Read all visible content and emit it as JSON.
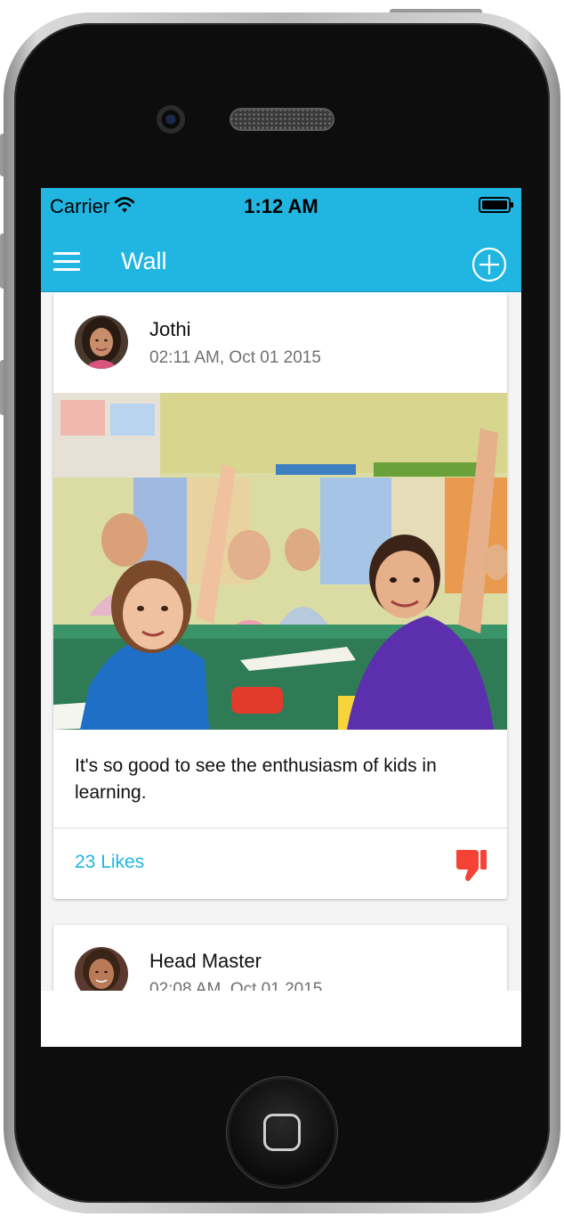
{
  "status_bar": {
    "carrier": "Carrier",
    "time": "1:12 AM",
    "icons": [
      "wifi-icon",
      "battery-icon"
    ]
  },
  "app_bar": {
    "title": "Wall",
    "left_icon": "menu-icon",
    "right_icon": "add-circle-icon",
    "color": "#21b6e2"
  },
  "feed": {
    "posts": [
      {
        "author": "Jothi",
        "time": "02:11 AM, Oct 01 2015",
        "image": "classroom-photo",
        "text": "It's so good to see the enthusiasm of kids in learning.",
        "likes": "23 Likes",
        "reaction_icon": "thumbs-down-icon",
        "reaction_color": "#f44336"
      },
      {
        "author": "Head Master",
        "time": "02:08 AM, Oct 01 2015"
      }
    ]
  }
}
